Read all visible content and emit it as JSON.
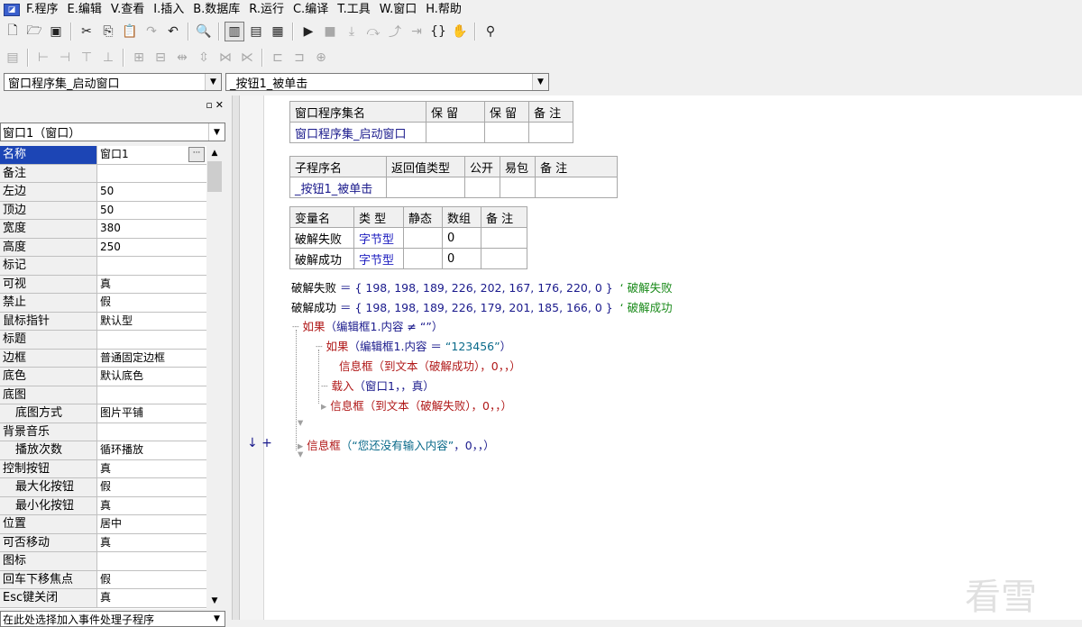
{
  "menu": [
    {
      "label": "F.程序"
    },
    {
      "label": "E.编辑"
    },
    {
      "label": "V.查看"
    },
    {
      "label": "I.插入"
    },
    {
      "label": "B.数据库"
    },
    {
      "label": "R.运行"
    },
    {
      "label": "C.编译"
    },
    {
      "label": "T.工具"
    },
    {
      "label": "W.窗口"
    },
    {
      "label": "H.帮助"
    }
  ],
  "combos": {
    "assembly": "窗口程序集_启动窗口",
    "subroutine": "_按钮1_被单击"
  },
  "left_panel": {
    "object_selector": "窗口1（窗口）",
    "properties": [
      {
        "name": "名称",
        "value": "窗口1",
        "selected": true
      },
      {
        "name": "备注",
        "value": ""
      },
      {
        "name": "左边",
        "value": "50"
      },
      {
        "name": "顶边",
        "value": "50"
      },
      {
        "name": "宽度",
        "value": "380"
      },
      {
        "name": "高度",
        "value": "250"
      },
      {
        "name": "标记",
        "value": ""
      },
      {
        "name": "可视",
        "value": "真"
      },
      {
        "name": "禁止",
        "value": "假"
      },
      {
        "name": "鼠标指针",
        "value": "默认型"
      },
      {
        "name": "标题",
        "value": ""
      },
      {
        "name": "边框",
        "value": "普通固定边框"
      },
      {
        "name": "底色",
        "value": "默认底色"
      },
      {
        "name": "底图",
        "value": ""
      },
      {
        "name": "底图方式",
        "value": "图片平铺",
        "indent": true
      },
      {
        "name": "背景音乐",
        "value": ""
      },
      {
        "name": "播放次数",
        "value": "循环播放",
        "indent": true
      },
      {
        "name": "控制按钮",
        "value": "真"
      },
      {
        "name": "最大化按钮",
        "value": "假",
        "indent": true
      },
      {
        "name": "最小化按钮",
        "value": "真",
        "indent": true
      },
      {
        "name": "位置",
        "value": "居中"
      },
      {
        "name": "可否移动",
        "value": "真"
      },
      {
        "name": "图标",
        "value": ""
      },
      {
        "name": "回车下移焦点",
        "value": "假"
      },
      {
        "name": "Esc键关闭",
        "value": "真"
      }
    ],
    "event_selector": "在此处选择加入事件处理子程序"
  },
  "editor": {
    "assembly_table": {
      "headers": [
        "窗口程序集名",
        "保 留",
        "保 留",
        "备 注"
      ],
      "row": [
        "窗口程序集_启动窗口",
        "",
        "",
        ""
      ]
    },
    "sub_table": {
      "headers": [
        "子程序名",
        "返回值类型",
        "公开",
        "易包",
        "备 注"
      ],
      "row": [
        "_按钮1_被单击",
        "",
        "",
        "",
        ""
      ]
    },
    "var_table": {
      "headers": [
        "变量名",
        "类 型",
        "静态",
        "数组",
        "备 注"
      ],
      "rows": [
        [
          "破解失败",
          "字节型",
          "",
          "0",
          ""
        ],
        [
          "破解成功",
          "字节型",
          "",
          "0",
          ""
        ]
      ]
    },
    "code": {
      "l1_var": "破解失败",
      "l1_val": " ＝ { 198, 198, 189, 226, 202, 167, 176, 220, 0 }",
      "l1_cm": "‘ 破解失败",
      "l2_var": "破解成功",
      "l2_val": " ＝ { 198, 198, 189, 226, 179, 201, 185, 166, 0 }",
      "l2_cm": "‘ 破解成功",
      "l3_kw": "如果",
      "l3_rest": "（编辑框1.内容 ≠ “”）",
      "l4_kw": "如果",
      "l4_a": "（编辑框1.内容 ＝ ",
      "l4_str": "“123456”",
      "l4_b": "）",
      "l5_kw": "信息框",
      "l5_rest": "（到文本（破解成功），0，，）",
      "l6_kw": "载入",
      "l6_rest": "（窗口1，，真）",
      "l7_kw": "信息框",
      "l7_rest": "（到文本（破解失败），0，，）",
      "l8_kw": "信息框",
      "l8_str": "（“您还没有输入内容”",
      "l8_rest": "，0，，）"
    },
    "gutter_marks": "↓ +"
  },
  "watermark": "看雪"
}
